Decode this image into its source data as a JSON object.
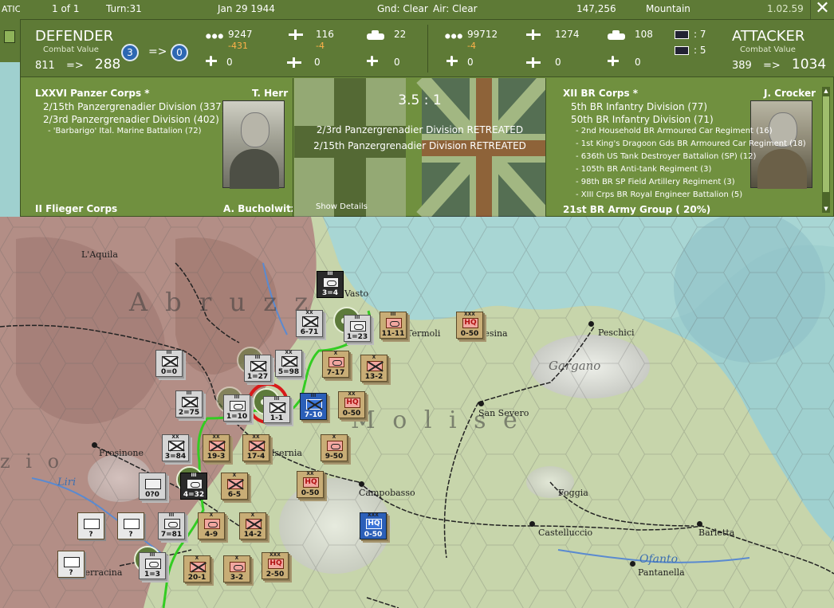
{
  "topbar": {
    "page": "1 of 1",
    "turn": "Turn:31",
    "date": "Jan 29 1944",
    "ground": "Gnd: Clear",
    "air": "Air: Clear",
    "hex_id": "147,256",
    "terrain": "Mountain",
    "version": "1.02.59",
    "close_label": "✕"
  },
  "left_strip": {
    "fragment": "ATIC"
  },
  "defender": {
    "title": "DEFENDER",
    "cv_label": "Combat Value",
    "cv_from": "811",
    "cv_arrow": "=>",
    "cv_to": "288",
    "men": "9247",
    "men_loss": "-431",
    "guns": "116",
    "guns_loss": "-4",
    "tanks": "22",
    "fighters": "0",
    "bombers": "0",
    "air_other": "0",
    "badge_from": "3",
    "badge_arrow": "=>",
    "badge_to": "0",
    "corps": "LXXVI Panzer Corps *",
    "commander": "T. Herr",
    "units": [
      "2/15th Panzergrenadier Division (337)",
      "2/3rd Panzergrenadier Division (402)"
    ],
    "subunits": [
      "- 'Barbarigo' Ital. Marine Battalion (72)"
    ],
    "cut_line_left": "II Flieger Corps",
    "cut_line_right": "A. Bucholwitz"
  },
  "attacker": {
    "title": "ATTACKER",
    "cv_label": "Combat Value",
    "cv_from": "389",
    "cv_arrow": "=>",
    "cv_to": "1034",
    "men": "99712",
    "men_loss": "-4",
    "guns": "1274",
    "tanks": "108",
    "fighters": "0",
    "bombers": "0",
    "air_other": "0",
    "extra1": ": 7",
    "extra2": ": 5",
    "corps": "XII BR Corps *",
    "commander": "J. Crocker",
    "units": [
      "5th BR Infantry Division (77)",
      "50th BR Infantry Division (71)"
    ],
    "subunits": [
      "- 2nd Household BR Armoured Car Regiment (16)",
      "- 1st King's Dragoon Gds BR Armoured Car Regiment (18)",
      "- 636th US Tank Destroyer Battalion (SP) (12)",
      "- 105th BR Anti-tank Regiment (3)",
      "- 98th BR SP Field Artillery Regiment (3)",
      "- XIII Crps BR Royal Engineer Battalion (5)"
    ],
    "cut_line": "21st BR Army Group ( 20%)"
  },
  "battle": {
    "odds": "3.5 : 1",
    "results": [
      "2/3rd Panzergrenadier Division RETREATED",
      "2/15th Panzergrenadier Division RETREATED"
    ],
    "show_details": "Show Details"
  },
  "map": {
    "regions": [
      {
        "name": "Abruzzi",
        "text": "A b r u z z"
      },
      {
        "name": "Molise",
        "text": "M o l i s e"
      },
      {
        "name": "Lazio",
        "text": "z i o"
      },
      {
        "name": "Gargano",
        "text": "Gargano"
      }
    ],
    "cities": [
      "L'Aquila",
      "Vasto",
      "Termoli",
      "Lesina",
      "Peschici",
      "San Severo",
      "Frosinone",
      "Isernia",
      "Campobasso",
      "Foggia",
      "Castelluccio",
      "Barletta",
      "Terracina",
      "Pantanella"
    ],
    "rivers": [
      "Liri",
      "Ofanto"
    ],
    "counters": [
      {
        "id": "c1",
        "str": "3=4",
        "size": "III"
      },
      {
        "id": "c2",
        "str": "6-71",
        "size": "XX"
      },
      {
        "id": "c3",
        "str": "1=23",
        "size": "III"
      },
      {
        "id": "c4",
        "str": "11-11",
        "size": "III"
      },
      {
        "id": "c5",
        "str": "0-50",
        "size": "XXX",
        "hq": "HQ"
      },
      {
        "id": "c6",
        "str": "0=0",
        "size": "III"
      },
      {
        "id": "c7",
        "str": "1=27",
        "size": "III"
      },
      {
        "id": "c8",
        "str": "5=98",
        "size": "XX"
      },
      {
        "id": "c9",
        "str": "7-17",
        "size": "X"
      },
      {
        "id": "c10",
        "str": "13-2",
        "size": "X"
      },
      {
        "id": "c11",
        "str": "2=75",
        "size": "III"
      },
      {
        "id": "c12",
        "str": "1=10",
        "size": "III"
      },
      {
        "id": "c13",
        "str": "1-1",
        "size": "III"
      },
      {
        "id": "c14",
        "str": "7-10",
        "size": "III"
      },
      {
        "id": "c15",
        "str": "0-50",
        "size": "XX",
        "hq": "HQ"
      },
      {
        "id": "c16",
        "str": "3=84",
        "size": "XX"
      },
      {
        "id": "c17",
        "str": "19-3",
        "size": "XX"
      },
      {
        "id": "c18",
        "str": "17-4",
        "size": "XX"
      },
      {
        "id": "c19",
        "str": "9-50",
        "size": "X"
      },
      {
        "id": "c20",
        "str": "0?0",
        "size": ""
      },
      {
        "id": "c21",
        "str": "4=32",
        "size": "III"
      },
      {
        "id": "c22",
        "str": "6-5",
        "size": "X"
      },
      {
        "id": "c23",
        "str": "0-50",
        "size": "XX",
        "hq": "HQ"
      },
      {
        "id": "c24",
        "str": "0-50",
        "size": "XXX",
        "hq": "HQ"
      },
      {
        "id": "c25",
        "str": "?",
        "size": ""
      },
      {
        "id": "c26",
        "str": "?",
        "size": ""
      },
      {
        "id": "c27",
        "str": "7=81",
        "size": "III"
      },
      {
        "id": "c28",
        "str": "4-9",
        "size": "X"
      },
      {
        "id": "c29",
        "str": "14-2",
        "size": "X"
      },
      {
        "id": "c30",
        "str": "?",
        "size": ""
      },
      {
        "id": "c31",
        "str": "1=3",
        "size": "III"
      },
      {
        "id": "c32",
        "str": "20-1",
        "size": "X"
      },
      {
        "id": "c33",
        "str": "3-2",
        "size": "X"
      },
      {
        "id": "c34",
        "str": "2-50",
        "size": "XXX",
        "hq": "HQ"
      }
    ]
  },
  "colors": {
    "panel_dark": "#5e7a36",
    "panel": "#70903f",
    "front_line": "#33cc22",
    "combat_ring": "#d81a1a",
    "loss": "#ffb24a"
  }
}
